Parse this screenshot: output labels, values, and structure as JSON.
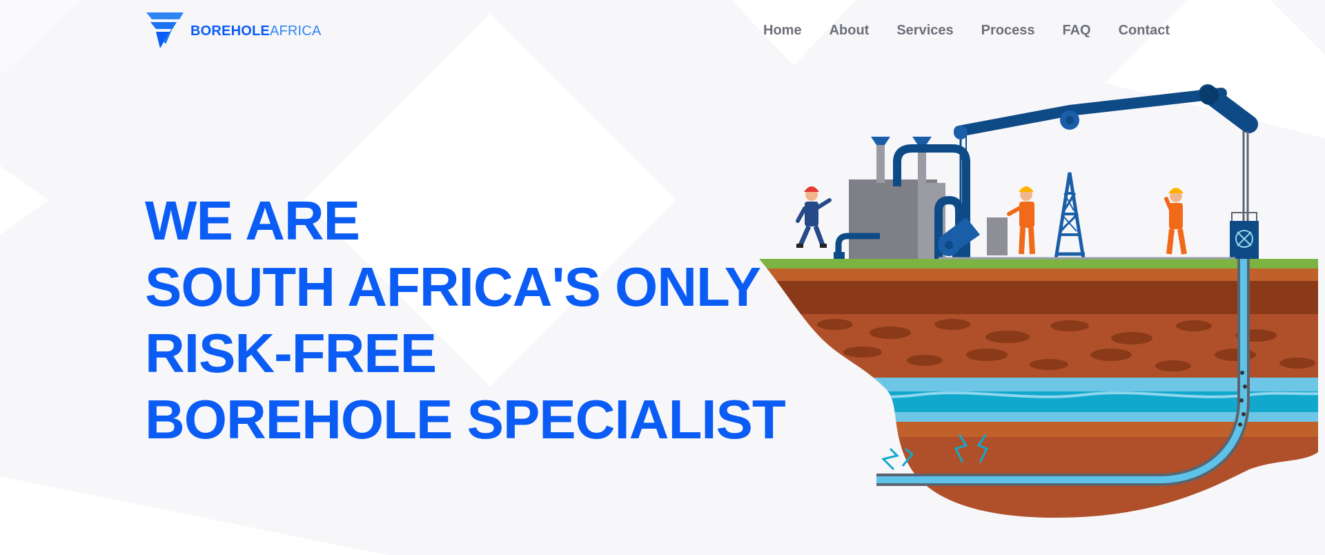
{
  "brand": {
    "name_bold": "BOREHOLE",
    "name_light": "AFRICA",
    "logo_icon": "chevron-stack-logo",
    "primary_color": "#0a5cf5",
    "secondary_color": "#2f86f0"
  },
  "nav": {
    "items": [
      {
        "label": "Home"
      },
      {
        "label": "About"
      },
      {
        "label": "Services"
      },
      {
        "label": "Process"
      },
      {
        "label": "FAQ"
      },
      {
        "label": "Contact"
      }
    ],
    "text_color": "#6c6f78"
  },
  "hero": {
    "lines": [
      "WE ARE",
      "SOUTH AFRICA'S ONLY",
      "RISK-FREE",
      "BOREHOLE SPECIALIST"
    ],
    "illustration": "borehole-drilling-site-cross-section"
  }
}
